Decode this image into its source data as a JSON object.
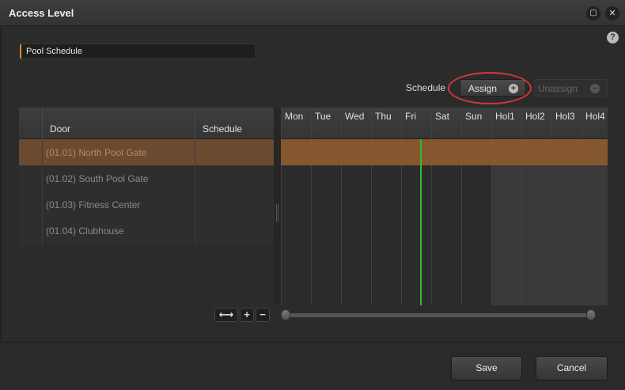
{
  "window": {
    "title": "Access Level",
    "maximize_icon": "maximize-icon",
    "close_icon": "close-icon"
  },
  "name_field": {
    "value": "Pool Schedule"
  },
  "toolbar": {
    "schedule_label": "Schedule",
    "assign_label": "Assign",
    "unassign_label": "Unassign"
  },
  "grid": {
    "columns": {
      "door": "Door",
      "schedule": "Schedule"
    },
    "rows": [
      {
        "door": "(01.01) North Pool Gate",
        "schedule": ""
      },
      {
        "door": "(01.02) South Pool Gate",
        "schedule": ""
      },
      {
        "door": "(01.03) Fitness Center",
        "schedule": ""
      },
      {
        "door": "(01.04) Clubhouse",
        "schedule": ""
      }
    ],
    "selected_row": 0
  },
  "timeline": {
    "days": [
      "Mon",
      "Tue",
      "Wed",
      "Thu",
      "Fri",
      "Sat",
      "Sun",
      "Hol1",
      "Hol2",
      "Hol3",
      "Hol4"
    ]
  },
  "footer": {
    "save_label": "Save",
    "cancel_label": "Cancel"
  },
  "colors": {
    "accent": "#e08a2c",
    "selection": "#8a5a2e",
    "current_time": "#2fbf2f",
    "highlight": "#d63535"
  }
}
